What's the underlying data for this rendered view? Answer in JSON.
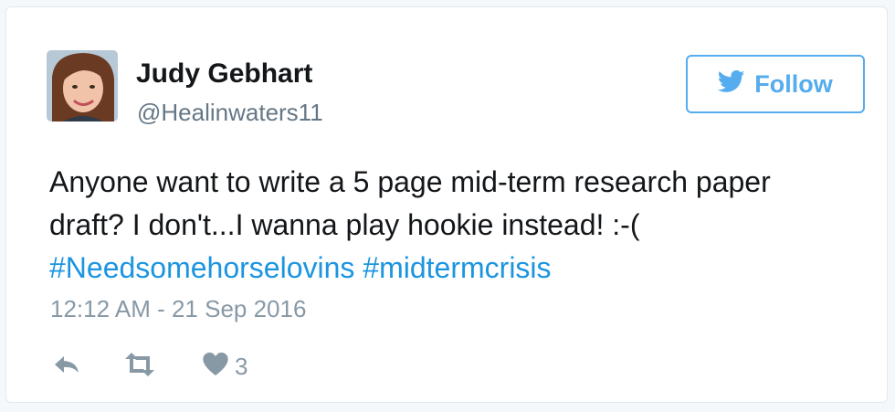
{
  "author": {
    "name": "Judy Gebhart",
    "handle": "@Healinwaters11"
  },
  "follow_button": {
    "label": "Follow",
    "icon": "twitter-bird-icon"
  },
  "tweet": {
    "text_line1": "Anyone want to write a 5 page mid-term research paper",
    "text_line2": "draft? I don't...I wanna play hookie instead! :-(",
    "hashtags": [
      "#Needsomehorselovins",
      "#midtermcrisis"
    ],
    "timestamp": "12:12 AM - 21 Sep 2016"
  },
  "actions": {
    "reply_icon": "reply-icon",
    "retweet_icon": "retweet-icon",
    "like_icon": "heart-icon",
    "like_count": "3"
  },
  "colors": {
    "accent": "#55acee",
    "hashtag": "#1b95e0",
    "muted": "#8899a6",
    "text": "#14171a"
  }
}
